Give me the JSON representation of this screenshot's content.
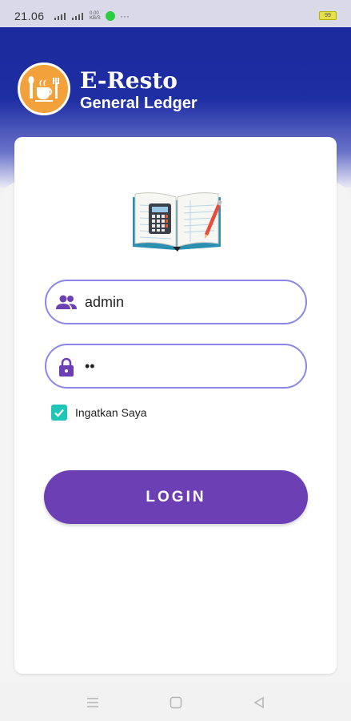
{
  "status_bar": {
    "time": "21.06",
    "battery": "99",
    "net_speed": "0.00 KB/S",
    "more": "···"
  },
  "header": {
    "title": "E-Resto",
    "subtitle": "General Ledger"
  },
  "login_form": {
    "username_value": "admin",
    "password_value": "••",
    "remember_label": "Ingatkan Saya",
    "remember_checked": true,
    "login_label": "LOGIN"
  },
  "colors": {
    "primary": "#1b2a9c",
    "button": "#6c3fb5",
    "field_border": "#8b86e8",
    "checkbox": "#1fc6b7",
    "logo_bg": "#f3a13a"
  },
  "icons": {
    "username": "people-icon",
    "password": "lock-icon",
    "nav": [
      "menu-icon",
      "home-square-icon",
      "back-triangle-icon"
    ]
  }
}
